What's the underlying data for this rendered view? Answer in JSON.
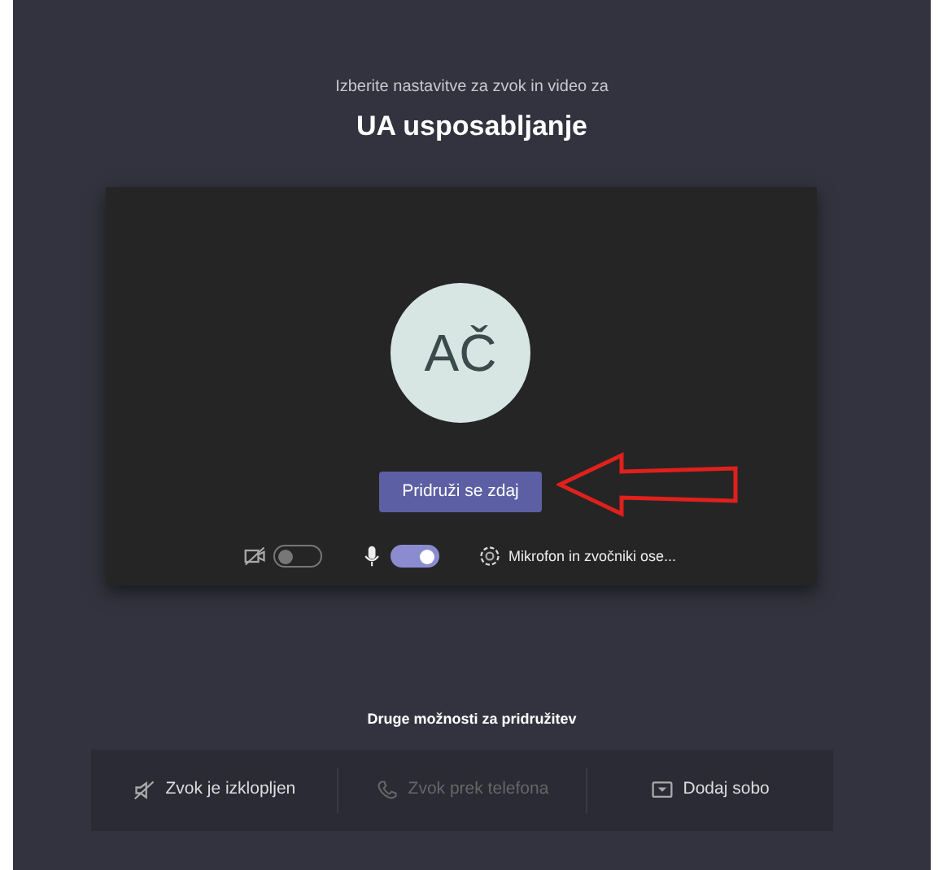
{
  "prompt": "Izberite nastavitve za zvok in video za",
  "meeting_title": "UA usposabljanje",
  "preview": {
    "initials": "AČ",
    "join_button": "Pridruži se zdaj"
  },
  "controls": [
    {
      "kind": "camera",
      "on": false
    },
    {
      "kind": "mic",
      "on": true
    },
    {
      "kind": "devices",
      "label": "Mikrofon in zvočniki ose..."
    }
  ],
  "other_options": {
    "heading": "Druge možnosti za pridružitev",
    "options": [
      {
        "kind": "audio-off",
        "label": "Zvok je izklopljen",
        "disabled": false
      },
      {
        "kind": "phone",
        "label": "Zvok prek telefona",
        "disabled": true
      },
      {
        "kind": "room",
        "label": "Dodaj sobo",
        "disabled": false
      }
    ]
  }
}
